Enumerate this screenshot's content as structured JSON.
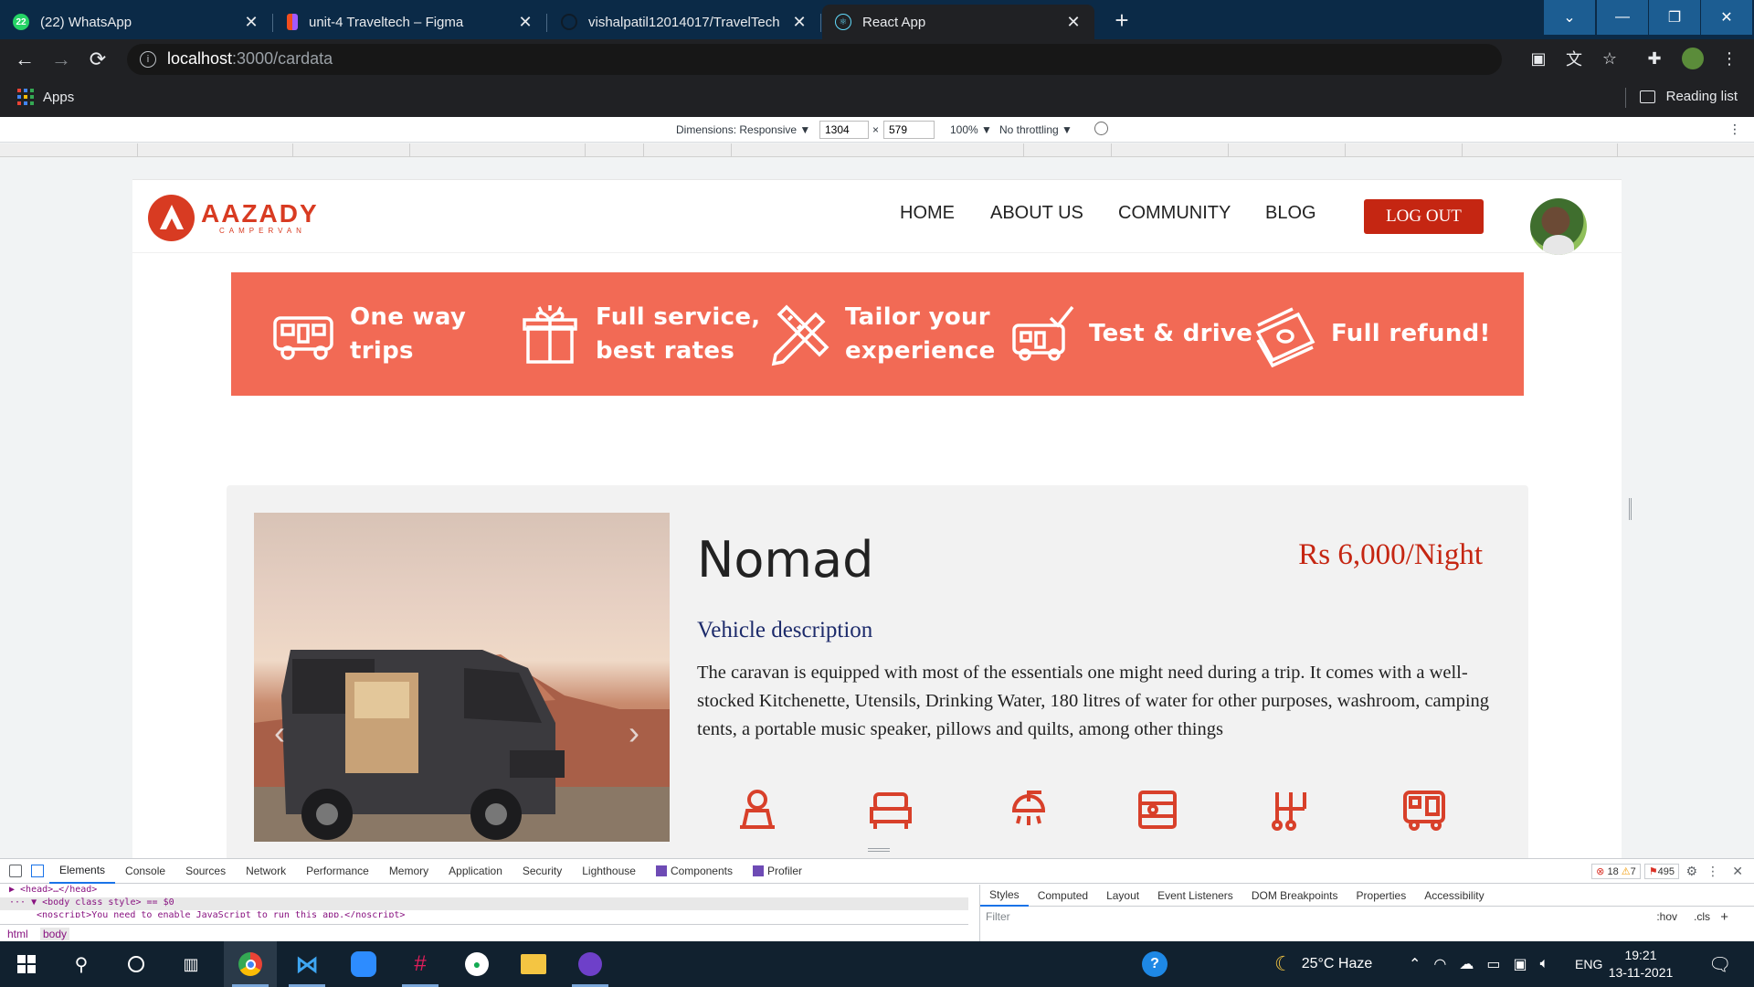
{
  "browser": {
    "tabs": [
      {
        "title": "(22) WhatsApp",
        "icon": "whatsapp-icon"
      },
      {
        "title": "unit-4 Traveltech – Figma",
        "icon": "figma-icon"
      },
      {
        "title": "vishalpatil12014017/TravelTech",
        "icon": "github-icon"
      },
      {
        "title": "React App",
        "icon": "react-icon"
      }
    ],
    "url_host": "localhost",
    "url_path": ":3000/cardata",
    "bookmarks_apps": "Apps",
    "reading_list": "Reading list"
  },
  "device_toolbar": {
    "dimensions_label": "Dimensions: Responsive ▼",
    "width": "1304",
    "height": "579",
    "times": "×",
    "zoom": "100% ▼",
    "throttling": "No throttling ▼"
  },
  "site": {
    "logo_name": "AAZADY",
    "logo_sub": "CAMPERVAN",
    "nav": [
      "HOME",
      "ABOUT US",
      "COMMUNITY",
      "BLOG"
    ],
    "logout": "LOG OUT",
    "features": [
      {
        "icon": "campervan-icon",
        "line1": "One way",
        "line2": "trips"
      },
      {
        "icon": "gift-box-icon",
        "line1": "Full service,",
        "line2": "best rates"
      },
      {
        "icon": "pencil-ruler-icon",
        "line1": "Tailor your",
        "line2": "experience"
      },
      {
        "icon": "van-check-icon",
        "line1": "Test & drive",
        "line2": ""
      },
      {
        "icon": "money-stack-icon",
        "line1": "Full refund!",
        "line2": ""
      }
    ],
    "banner_color": "#f26a55",
    "accent_color": "#c52612",
    "vehicle": {
      "name": "Nomad",
      "price": "Rs 6,000/Night",
      "desc_heading": "Vehicle description",
      "description": "The caravan is equipped with most of the essentials one might need during a trip. It comes with a well-stocked Kitchenette, Utensils, Drinking Water, 180 litres of water for other purposes, washroom, camping tents, a portable music speaker, pillows and quilts, among other things",
      "amenities": [
        "driver-seat-icon",
        "sofa-bed-icon",
        "shower-icon",
        "kitchen-stove-icon",
        "gear-shift-icon",
        "caravan-icon"
      ]
    }
  },
  "devtools": {
    "tabs": [
      "Elements",
      "Console",
      "Sources",
      "Network",
      "Performance",
      "Memory",
      "Application",
      "Security",
      "Lighthouse",
      "Components",
      "Profiler"
    ],
    "errors": "18",
    "warnings": "7",
    "issues": "495",
    "dom_lines": [
      "▶ <head>…</head>",
      "··· ▼ <body class style> == $0",
      "  <noscript>You need to enable JavaScript to run this app.</noscript>"
    ],
    "breadcrumbs": [
      "html",
      "body"
    ],
    "style_tabs": [
      "Styles",
      "Computed",
      "Layout",
      "Event Listeners",
      "DOM Breakpoints",
      "Properties",
      "Accessibility"
    ],
    "filter_placeholder": "Filter",
    "hov": ":hov",
    "cls": ".cls"
  },
  "taskbar": {
    "weather": "25°C  Haze",
    "language": "ENG",
    "time": "19:21",
    "date": "13-11-2021"
  }
}
